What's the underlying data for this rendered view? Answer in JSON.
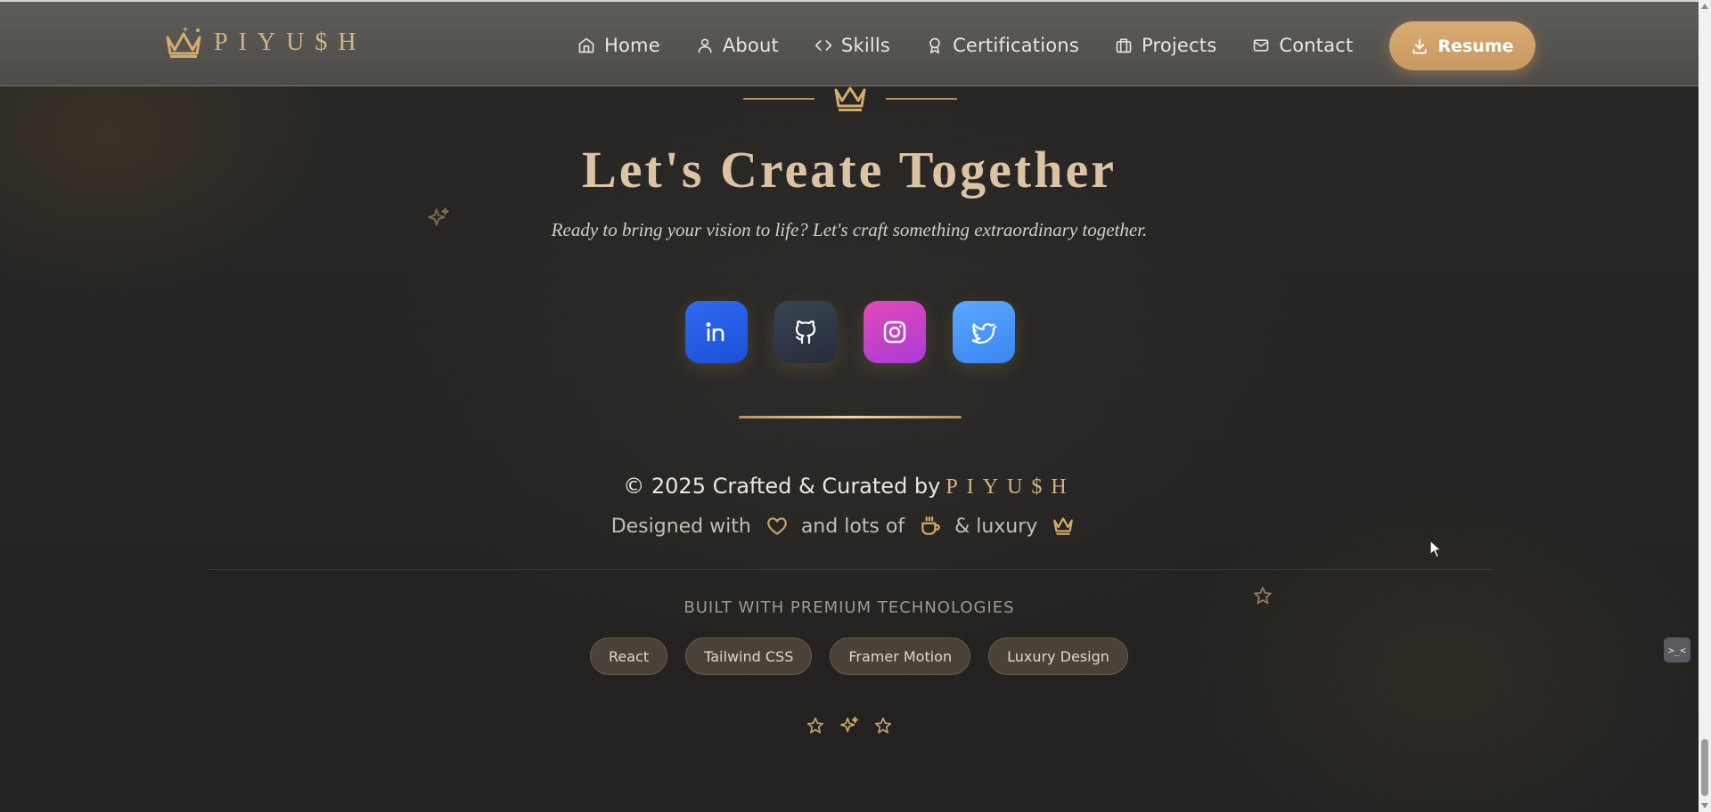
{
  "nav": {
    "logo_text": "PIYU$H",
    "items": [
      {
        "label": "Home",
        "icon": "home-icon"
      },
      {
        "label": "About",
        "icon": "user-icon"
      },
      {
        "label": "Skills",
        "icon": "code-icon"
      },
      {
        "label": "Certifications",
        "icon": "award-icon"
      },
      {
        "label": "Projects",
        "icon": "briefcase-icon"
      },
      {
        "label": "Contact",
        "icon": "mail-icon"
      }
    ],
    "resume_label": "Resume"
  },
  "hero": {
    "title": "Let's Create Together",
    "subtitle": "Ready to bring your vision to life? Let's craft something extraordinary together."
  },
  "socials": [
    {
      "name": "linkedin",
      "icon": "linkedin-icon"
    },
    {
      "name": "github",
      "icon": "github-icon"
    },
    {
      "name": "instagram",
      "icon": "instagram-icon"
    },
    {
      "name": "twitter",
      "icon": "twitter-icon"
    }
  ],
  "footer": {
    "copyright_prefix": "© 2025 Crafted & Curated by",
    "brand": "PIYU$H",
    "designed_with": "Designed with",
    "and_lots_of": "and lots of",
    "and_luxury": "& luxury",
    "built_heading": "BUILT WITH PREMIUM TECHNOLOGIES",
    "tags": [
      "React",
      "Tailwind CSS",
      "Framer Motion",
      "Luxury Design"
    ]
  },
  "dev_widget": {
    "label": ">_<"
  },
  "colors": {
    "accent_gold": "#d6b381",
    "resume_button": "#d3a66c",
    "background": "#252422",
    "navbar": "#575552"
  }
}
